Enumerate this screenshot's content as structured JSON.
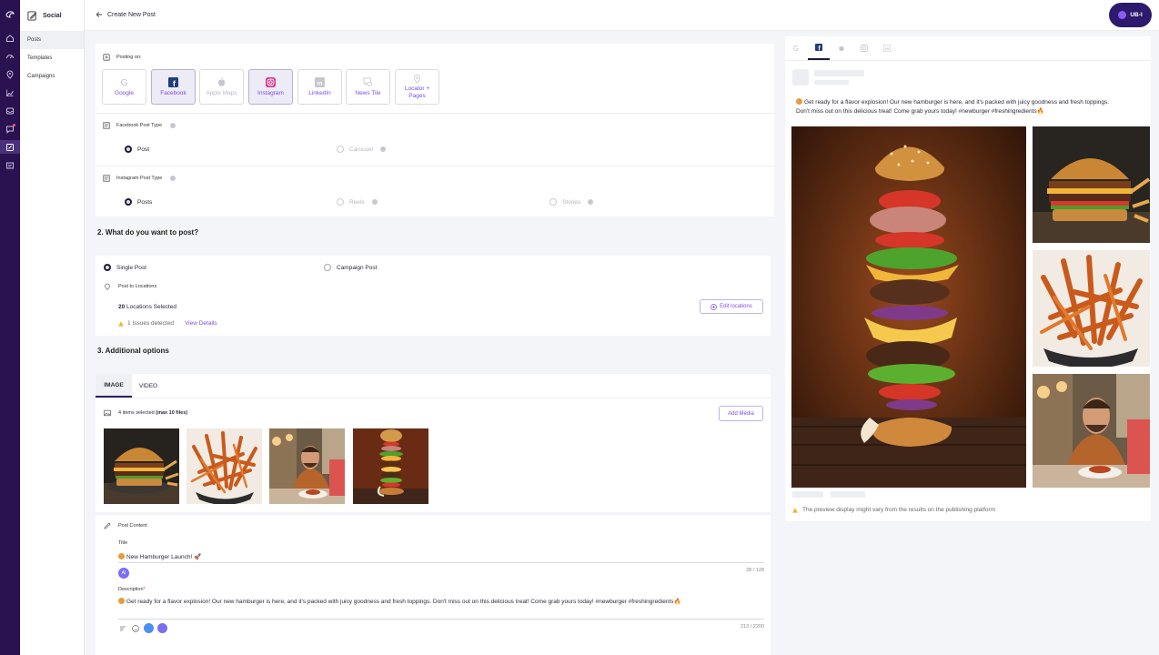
{
  "app": {
    "name": "Social"
  },
  "rail": {
    "icons": [
      "app-logo-icon",
      "home-icon",
      "dashboard-icon",
      "location-icon",
      "reports-icon",
      "inbox-icon",
      "reviews-icon",
      "social-icon",
      "listings-icon"
    ]
  },
  "sidebar": {
    "items": [
      {
        "label": "Posts"
      },
      {
        "label": "Templates"
      },
      {
        "label": "Campaigns"
      }
    ]
  },
  "header": {
    "back_label": "Create New Post",
    "user_label": "UB-I"
  },
  "posting": {
    "label": "Posting on:",
    "networks": [
      {
        "label": "Google",
        "state": "normal"
      },
      {
        "label": "Facebook",
        "state": "selected"
      },
      {
        "label": "Apple Maps",
        "state": "disabled"
      },
      {
        "label": "Instagram",
        "state": "selected"
      },
      {
        "label": "LinkedIn",
        "state": "normal"
      },
      {
        "label": "News Tile",
        "state": "normal"
      },
      {
        "label_line1": "Locator +",
        "label_line2": "Pages",
        "state": "normal"
      }
    ]
  },
  "fb_type": {
    "label": "Facebook Post Type",
    "options": [
      "Post",
      "Carousel"
    ],
    "selected": "Post"
  },
  "ig_type": {
    "label": "Instagram Post Type",
    "options": [
      "Posts",
      "Reels",
      "Stories"
    ],
    "selected": "Posts"
  },
  "section2": {
    "title": "2.  What do you want to post?"
  },
  "post_kind": {
    "options": [
      "Single Post",
      "Campaign Post"
    ],
    "selected": "Single Post"
  },
  "locations": {
    "label": "Post to Locations",
    "count": "20",
    "count_suffix": "Locations Selected",
    "issues": "1 Issues detected",
    "view_details": "View Details",
    "edit_button": "Edit locations"
  },
  "section3": {
    "title": "3.  Additional options"
  },
  "media": {
    "tabs": [
      "IMAGE",
      "VIDEO"
    ],
    "active_tab": "IMAGE",
    "selected_text": "4 items selected",
    "max_text": "(max 10 files)",
    "add_button": "Add Media",
    "thumbnails": [
      "burger-photo",
      "fries-photo",
      "man-eating-photo",
      "flying-burger-photo"
    ]
  },
  "content": {
    "label": "Post Content",
    "title_label": "Title",
    "title_value": "New Hamburger Launch! 🚀",
    "title_count": "28 / 128",
    "desc_label": "Description",
    "desc_required": "*",
    "desc_value": "Get ready for a flavor explosion! Our new hamburger is here, and it's packed with juicy goodness and fresh toppings. Don't miss out on this delicious treat! Come grab yours today! #newburger #freshingredients🔥",
    "desc_count": "213 / 2200",
    "ai_badge": "AI"
  },
  "preview": {
    "tabs": [
      "google-icon",
      "facebook-icon",
      "apple-icon",
      "instagram-icon",
      "linkedin-icon"
    ],
    "active_tab": "facebook-icon",
    "text_line1": "Get ready for a flavor explosion! Our new hamburger is here, and it's packed with juicy goodness and fresh toppings.",
    "text_line2": "Don't miss out on this delicious treat! Come grab yours today! #newburger #freshingredients🔥",
    "note": "The preview display might vary from the results on the publishing platform"
  },
  "colors": {
    "rail": "#29124f",
    "accent": "#7b4fe0",
    "user_pill": "#2d1a6e"
  }
}
